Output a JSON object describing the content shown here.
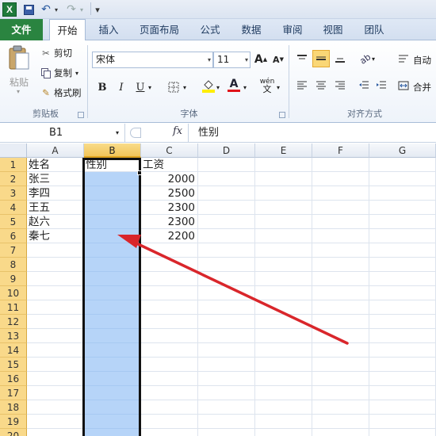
{
  "qat": {
    "undo": "↶",
    "redo": "↷",
    "customize": "▾"
  },
  "tabs": [
    "文件",
    "开始",
    "插入",
    "页面布局",
    "公式",
    "数据",
    "审阅",
    "视图",
    "团队"
  ],
  "ribbon": {
    "clipboard": {
      "paste": "粘贴",
      "cut": "剪切",
      "copy": "复制",
      "format_painter": "格式刷",
      "label": "剪贴板"
    },
    "font": {
      "font_name": "宋体",
      "font_size": "11",
      "bold": "B",
      "italic": "I",
      "underline": "U",
      "grow": "A",
      "shrink": "A",
      "phonetic": "wén",
      "label": "字体"
    },
    "alignment": {
      "wrap": "自动",
      "merge": "合并",
      "label": "对齐方式"
    }
  },
  "formula_bar": {
    "name_box": "B1",
    "fx": "fx",
    "value": "性别"
  },
  "grid": {
    "columns": [
      "A",
      "B",
      "C",
      "D",
      "E",
      "F",
      "G"
    ],
    "rows": [
      "1",
      "2",
      "3",
      "4",
      "5",
      "6",
      "7",
      "8",
      "9",
      "10",
      "11",
      "12",
      "13",
      "14",
      "15",
      "16",
      "17",
      "18",
      "19",
      "20"
    ],
    "cells": {
      "A1": "姓名",
      "B1": "性别",
      "C1": "工资",
      "A2": "张三",
      "C2": "2000",
      "A3": "李四",
      "C3": "2500",
      "A4": "王五",
      "C4": "2300",
      "A5": "赵六",
      "C5": "2300",
      "A6": "秦七",
      "C6": "2200"
    },
    "selected_column": "B",
    "active_cell": "B1"
  },
  "annotation": {
    "arrow_color": "#d9262b"
  },
  "colors": {
    "file_tab": "#2a8440",
    "selection": "#b6d4f8",
    "row_header": "#f9d98a"
  }
}
